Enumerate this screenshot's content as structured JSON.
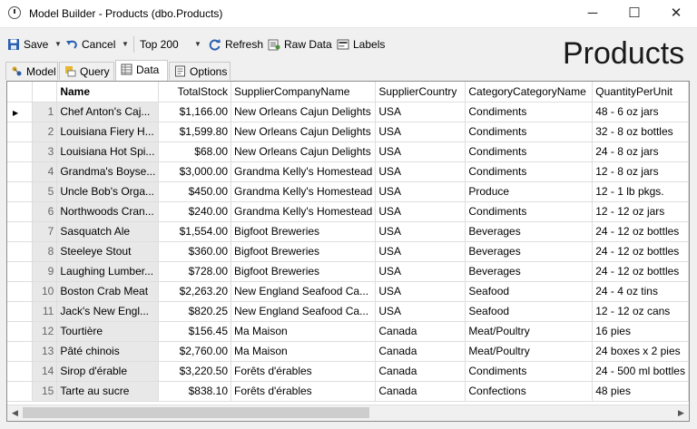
{
  "window": {
    "title": "Model Builder - Products (dbo.Products)",
    "min": "─",
    "max": "☐",
    "close": "✕"
  },
  "toolbar": {
    "save": "Save",
    "cancel": "Cancel",
    "top": "Top 200",
    "refresh": "Refresh",
    "raw": "Raw Data",
    "labels": "Labels"
  },
  "heading": "Products",
  "tabs": [
    {
      "label": "Model"
    },
    {
      "label": "Query"
    },
    {
      "label": "Data"
    },
    {
      "label": "Options"
    }
  ],
  "grid": {
    "columns": [
      "Name",
      "TotalStock",
      "SupplierCompanyName",
      "SupplierCountry",
      "CategoryCategoryName",
      "QuantityPerUnit"
    ],
    "rows": [
      [
        "1",
        "Chef Anton's Caj...",
        "$1,166.00",
        "New Orleans Cajun Delights",
        "USA",
        "Condiments",
        "48 - 6 oz jars"
      ],
      [
        "2",
        "Louisiana Fiery H...",
        "$1,599.80",
        "New Orleans Cajun Delights",
        "USA",
        "Condiments",
        "32 - 8 oz bottles"
      ],
      [
        "3",
        "Louisiana Hot Spi...",
        "$68.00",
        "New Orleans Cajun Delights",
        "USA",
        "Condiments",
        "24 - 8 oz jars"
      ],
      [
        "4",
        "Grandma's Boyse...",
        "$3,000.00",
        "Grandma Kelly's Homestead",
        "USA",
        "Condiments",
        "12 - 8 oz jars"
      ],
      [
        "5",
        "Uncle Bob's Orga...",
        "$450.00",
        "Grandma Kelly's Homestead",
        "USA",
        "Produce",
        "12 - 1 lb pkgs."
      ],
      [
        "6",
        "Northwoods Cran...",
        "$240.00",
        "Grandma Kelly's Homestead",
        "USA",
        "Condiments",
        "12 - 12 oz jars"
      ],
      [
        "7",
        "Sasquatch Ale",
        "$1,554.00",
        "Bigfoot Breweries",
        "USA",
        "Beverages",
        "24 - 12 oz bottles"
      ],
      [
        "8",
        "Steeleye Stout",
        "$360.00",
        "Bigfoot Breweries",
        "USA",
        "Beverages",
        "24 - 12 oz bottles"
      ],
      [
        "9",
        "Laughing Lumber...",
        "$728.00",
        "Bigfoot Breweries",
        "USA",
        "Beverages",
        "24 - 12 oz bottles"
      ],
      [
        "10",
        "Boston Crab Meat",
        "$2,263.20",
        "New England Seafood Ca...",
        "USA",
        "Seafood",
        "24 - 4 oz tins"
      ],
      [
        "11",
        "Jack's New Engl...",
        "$820.25",
        "New England Seafood Ca...",
        "USA",
        "Seafood",
        "12 - 12 oz cans"
      ],
      [
        "12",
        "Tourtière",
        "$156.45",
        "Ma Maison",
        "Canada",
        "Meat/Poultry",
        "16 pies"
      ],
      [
        "13",
        "Pâté chinois",
        "$2,760.00",
        "Ma Maison",
        "Canada",
        "Meat/Poultry",
        "24 boxes x 2 pies"
      ],
      [
        "14",
        "Sirop d'érable",
        "$3,220.50",
        "Forêts d'érables",
        "Canada",
        "Condiments",
        "24 - 500 ml bottles"
      ],
      [
        "15",
        "Tarte au sucre",
        "$838.10",
        "Forêts d'érables",
        "Canada",
        "Confections",
        "48 pies"
      ]
    ]
  },
  "icons": {
    "app": "clock-icon",
    "save": "floppy-disk-icon",
    "cancel": "undo-icon",
    "refresh": "refresh-icon",
    "raw": "raw-data-icon",
    "labels": "labels-icon",
    "current_row": "row-pointer-icon"
  }
}
